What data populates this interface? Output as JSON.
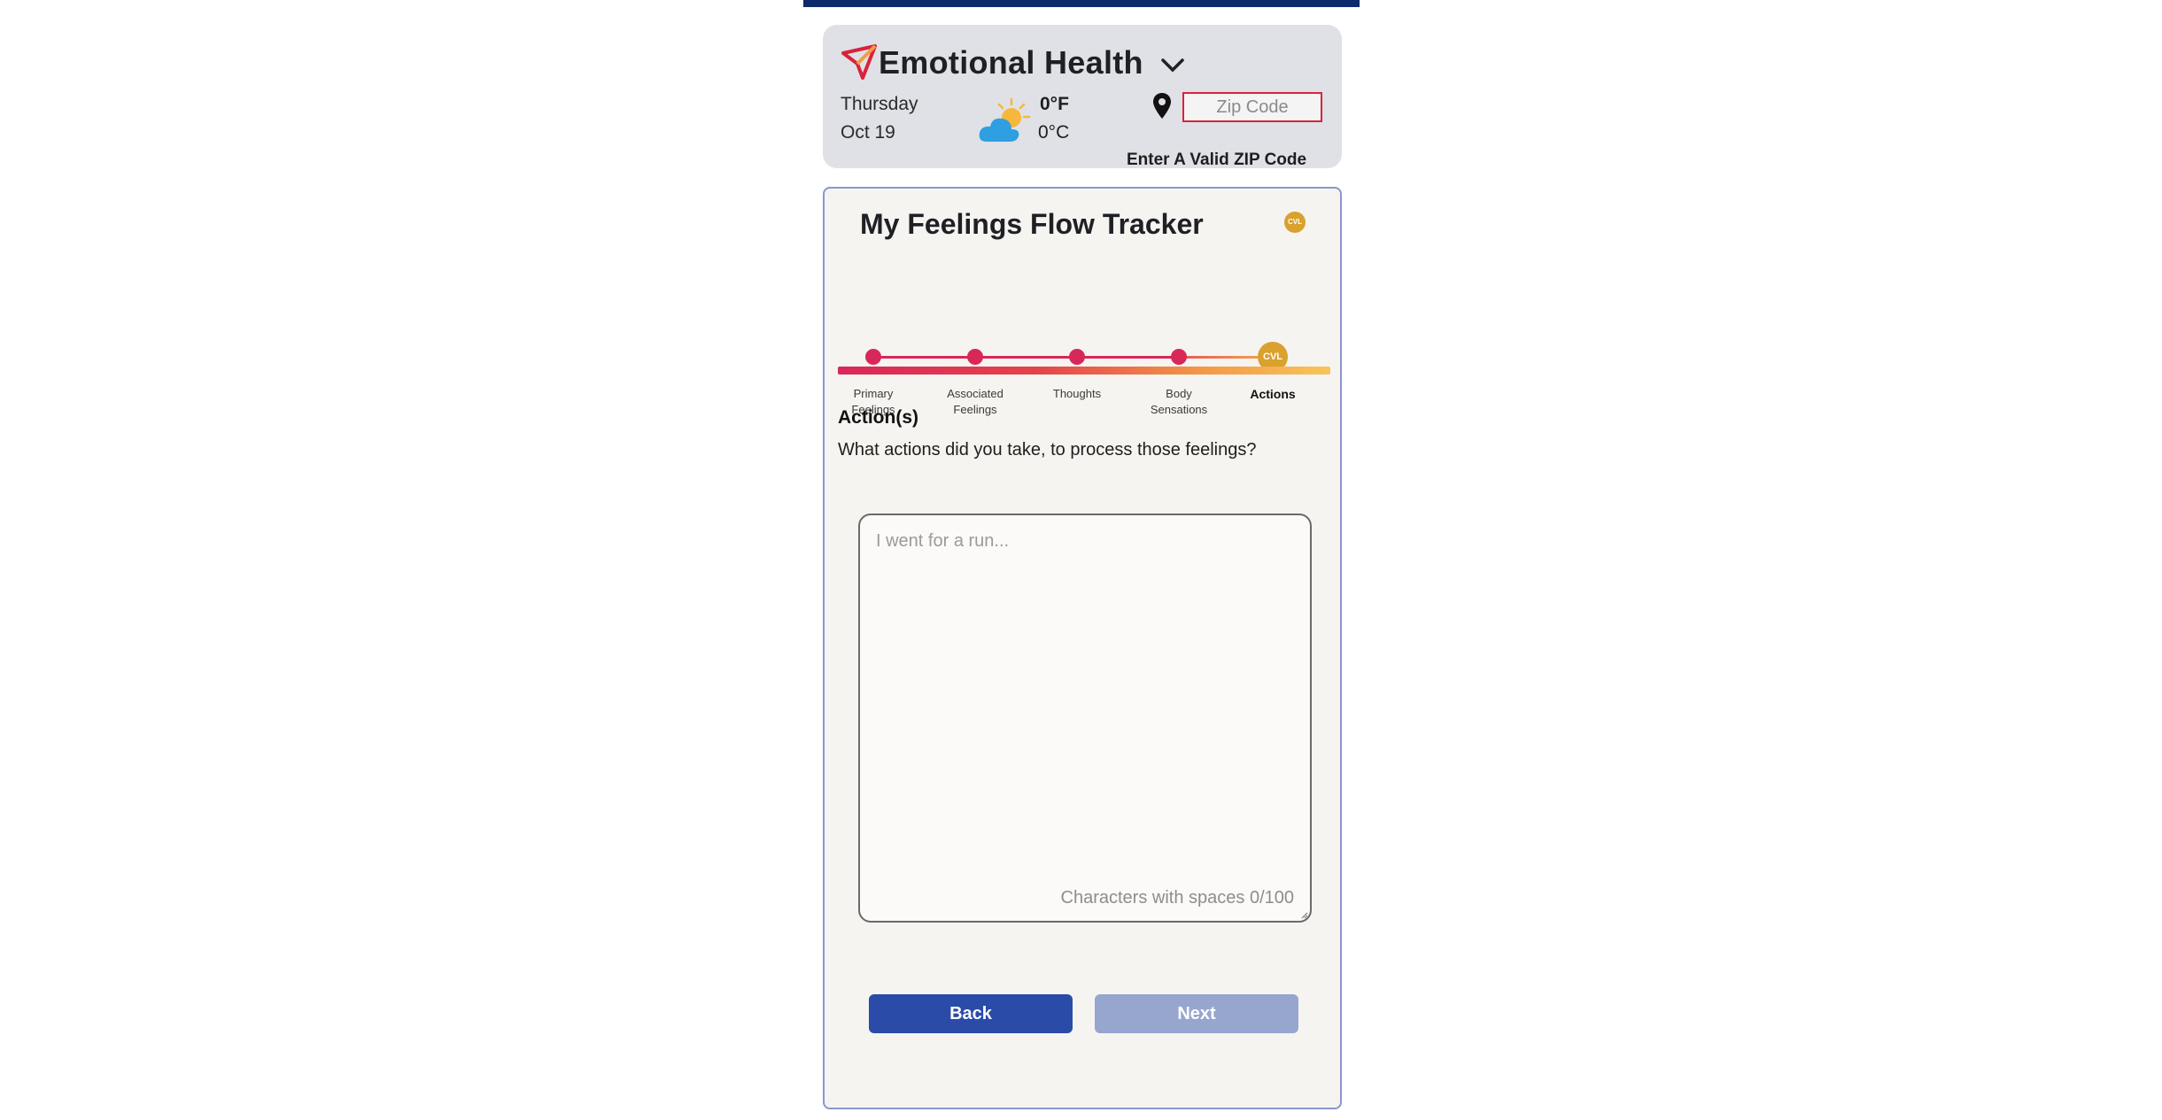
{
  "header": {
    "app_title": "Emotional Health",
    "day": "Thursday",
    "date": "Oct 19",
    "temp_f": "0°F",
    "temp_c": "0°C",
    "zip_placeholder": "Zip Code",
    "zip_value": "",
    "zip_error": "Enter A Valid ZIP Code"
  },
  "tracker": {
    "title": "My Feelings Flow Tracker",
    "badge": "CVL",
    "steps": [
      {
        "label_line1": "Primary",
        "label_line2": "Feelings"
      },
      {
        "label_line1": "Associated",
        "label_line2": "Feelings"
      },
      {
        "label_line1": "Thoughts",
        "label_line2": ""
      },
      {
        "label_line1": "Body",
        "label_line2": "Sensations"
      },
      {
        "label_line1": "Actions",
        "label_line2": ""
      }
    ],
    "current_step_badge": "CVL",
    "current_step_index": 4,
    "section_heading": "Action(s)",
    "question": "What actions did you take, to process those feelings?",
    "textarea_placeholder": "I went for a run...",
    "textarea_value": "",
    "char_count": "Characters with spaces 0/100",
    "back_label": "Back",
    "next_label": "Next"
  },
  "colors": {
    "top_bar": "#0d2a6b",
    "step_complete": "#d8285a",
    "step_current": "#d9a12e",
    "back_button": "#2a4ba8",
    "next_button_disabled": "#97a6cf",
    "zip_error_border": "#d8233b"
  },
  "icons": {
    "logo": "paper-plane-logo-icon",
    "dropdown": "chevron-down-icon",
    "weather": "partly-sunny-cloud-icon",
    "location": "map-pin-icon"
  }
}
